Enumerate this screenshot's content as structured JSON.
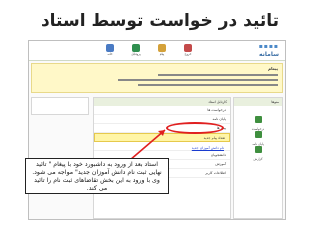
{
  "slide": {
    "title": "تائید در خواست توسط استاد"
  },
  "screenshot": {
    "logo_text": "سامانه",
    "nav": [
      {
        "label": "خانه",
        "icon": "home-icon",
        "color": "#4a7bc4"
      },
      {
        "label": "پروفایل",
        "icon": "profile-icon",
        "color": "#2f8f4f"
      },
      {
        "label": "پیام",
        "icon": "mail-icon",
        "color": "#d4a13a"
      },
      {
        "label": "خروج",
        "icon": "exit-icon",
        "color": "#c44a4a"
      }
    ],
    "banner_title": "پیغام",
    "right_column": {
      "header": "منوها",
      "items": [
        {
          "label": "درخواست",
          "icon": "folder-icon"
        },
        {
          "label": "پایان نامه",
          "icon": "folder-icon"
        },
        {
          "label": "گزارش",
          "icon": "folder-icon"
        }
      ]
    },
    "mid_panel": {
      "header": "کارتابل استاد",
      "rows": [
        "درخواست ها",
        "پایان نامه",
        "پیام ها",
        "تعداد پیام جدید",
        "دانشجویان",
        "آموزش",
        "اطلاعات کاربر"
      ],
      "highlight_link": "نام دانش آموزان جدید"
    }
  },
  "callout": {
    "text": "استاد بعد از ورود به داشبورد خود با پیغام \" تائید نهایی ثبت نام دانش آموزان جدید\" مواجه می شود. وی با ورود به این بخش تقاضاهای ثبت نام را تائید می کند."
  },
  "colors": {
    "annotation": "#e02020",
    "banner": "#fff8c8",
    "link": "#1a3ccf"
  }
}
